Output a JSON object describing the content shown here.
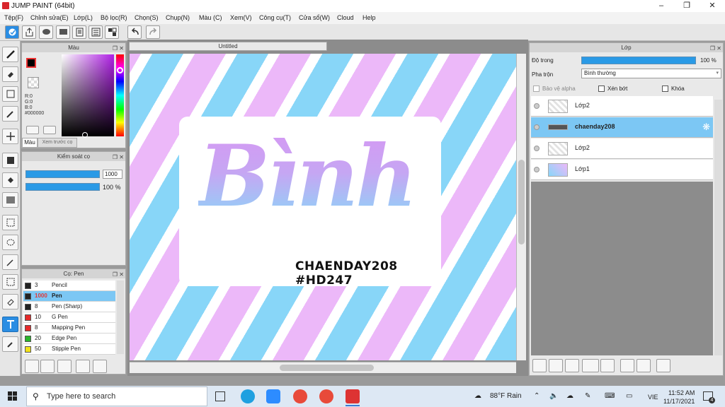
{
  "window": {
    "title": "JUMP PAINT (64bit)"
  },
  "menu": [
    "Tệp(F)",
    "Chỉnh sửa(E)",
    "Lớp(L)",
    "Bộ lọc(R)",
    "Chọn(S)",
    "Chụp(N)",
    "Màu (C)",
    "Xem(V)",
    "Công cụ(T)",
    "Cửa sổ(W)",
    "Cloud",
    "Help"
  ],
  "color_panel": {
    "title": "Màu",
    "rgb": {
      "r": "R:0",
      "g": "G:0",
      "b": "B:0",
      "hex": "#000000"
    },
    "tabs": [
      "Màu",
      "Xem trước cọ"
    ]
  },
  "brush_control": {
    "title": "Kiểm soát cọ",
    "size_value": "1000",
    "opacity_value": "100 %",
    "size_fraction": 1.0,
    "opacity_fraction": 1.0
  },
  "brush_panel": {
    "title": "Cọ: Pen",
    "items": [
      {
        "size": "3",
        "name": "Pencil",
        "color": "#222222"
      },
      {
        "size": "1000",
        "name": "Pen",
        "color": "#222222"
      },
      {
        "size": "8",
        "name": "Pen (Sharp)",
        "color": "#222222"
      },
      {
        "size": "10",
        "name": "G Pen",
        "color": "#e52a2a"
      },
      {
        "size": "8",
        "name": "Mapping Pen",
        "color": "#e52a2a"
      },
      {
        "size": "20",
        "name": "Edge Pen",
        "color": "#2ab52a"
      },
      {
        "size": "50",
        "name": "Stipple Pen",
        "color": "#f2e21a"
      }
    ]
  },
  "canvas": {
    "tab": "Untitled",
    "art_text": {
      "big": "Bình",
      "line1": "CHAENDAY208",
      "line2": "#HD247"
    },
    "colors": {
      "blue": "#88d6f8",
      "pink": "#ecb8f9"
    }
  },
  "layer_panel": {
    "title": "Lớp",
    "opacity_label": "Độ trong",
    "opacity_value": "100 %",
    "opacity_fraction": 1.0,
    "blend_label": "Pha trộn",
    "blend_value": "Bình thường",
    "options": {
      "alpha": "Bảo vệ alpha",
      "clip": "Xén bớt",
      "lock": "Khóa"
    },
    "layers": [
      {
        "name": "Lớp2",
        "selected": false
      },
      {
        "name": "chaenday208",
        "selected": true
      },
      {
        "name": "Lớp2",
        "selected": false
      },
      {
        "name": "Lớp1",
        "selected": false
      }
    ]
  },
  "taskbar": {
    "search_placeholder": "Type here to search",
    "weather": "88°F  Rain",
    "lang": "VIE",
    "time": "11:52 AM",
    "date": "11/17/2021",
    "notifications": "4"
  }
}
